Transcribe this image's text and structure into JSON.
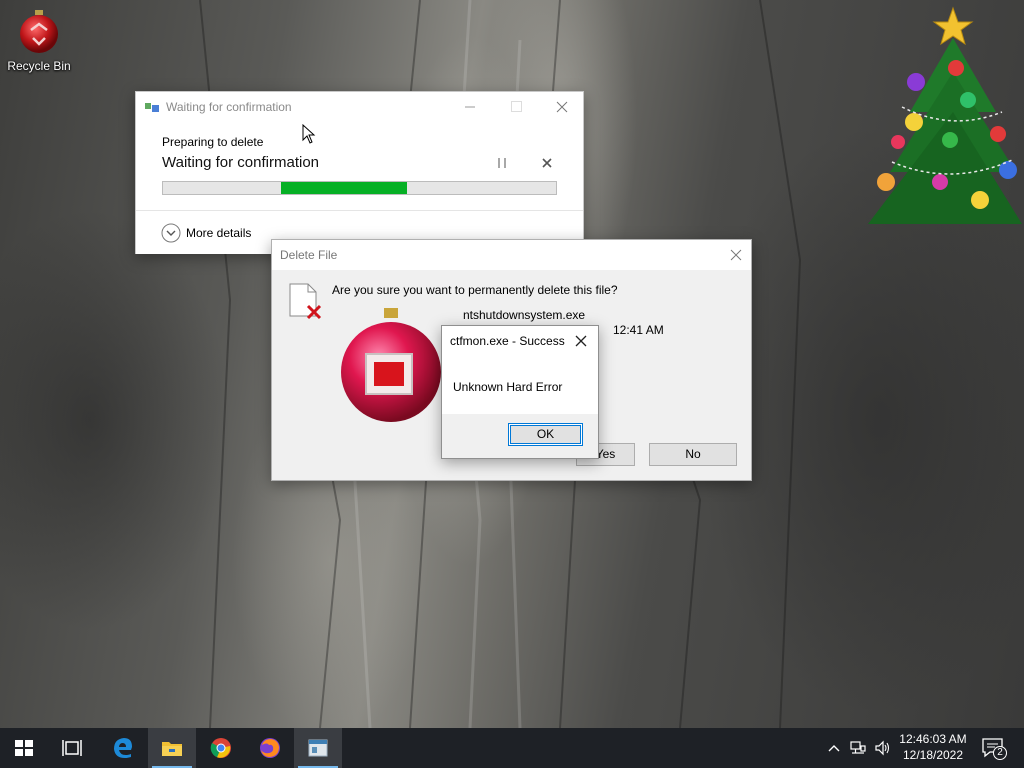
{
  "desktop": {
    "icons": [
      {
        "label": "Recycle Bin",
        "icon": "recycle-bin-icon"
      }
    ],
    "decorations": [
      "christmas-tree-icon",
      "christmas-ornament-icon"
    ]
  },
  "progress_dialog": {
    "title": "Waiting for confirmation",
    "subtitle": "Preparing to delete",
    "heading": "Waiting for confirmation",
    "progress_start_fraction": 0.3,
    "progress_end_fraction": 0.62,
    "details_label": "More details",
    "accent_color": "#06b025"
  },
  "delete_dialog": {
    "title": "Delete File",
    "question": "Are you sure you want to permanently delete this file?",
    "file_name": "ntshutdownsystem.exe",
    "file_date_visible": "12:41 AM",
    "yes_label": "Yes",
    "no_label": "No"
  },
  "message_box": {
    "title": "ctfmon.exe - Success",
    "message": "Unknown Hard Error",
    "ok_label": "OK"
  },
  "taskbar": {
    "apps": [
      {
        "name": "start",
        "icon": "windows-logo-icon"
      },
      {
        "name": "task-view",
        "icon": "task-view-icon"
      },
      {
        "name": "edge",
        "icon": "edge-icon"
      },
      {
        "name": "file-explorer",
        "icon": "folder-icon",
        "active": true
      },
      {
        "name": "chrome",
        "icon": "chrome-icon"
      },
      {
        "name": "firefox",
        "icon": "firefox-icon"
      },
      {
        "name": "notepad",
        "icon": "app-window-icon"
      }
    ],
    "tray": {
      "time": "12:46:03 AM",
      "date": "12/18/2022",
      "notification_count": "2"
    }
  }
}
